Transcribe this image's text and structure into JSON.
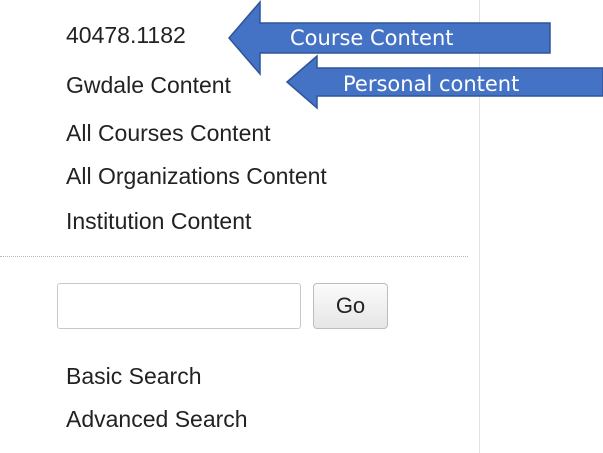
{
  "nav": {
    "items": [
      {
        "label": "40478.1182"
      },
      {
        "label": "Gwdale Content"
      },
      {
        "label": "All Courses Content"
      },
      {
        "label": "All Organizations Content"
      },
      {
        "label": "Institution Content"
      }
    ]
  },
  "search": {
    "value": "",
    "placeholder": "",
    "go_label": "Go"
  },
  "search_links": {
    "basic": "Basic Search",
    "advanced": "Advanced Search"
  },
  "annotations": {
    "course": "Course Content",
    "personal": "Personal content"
  },
  "colors": {
    "callout_fill": "#4472C4",
    "callout_stroke": "#2F5597"
  }
}
